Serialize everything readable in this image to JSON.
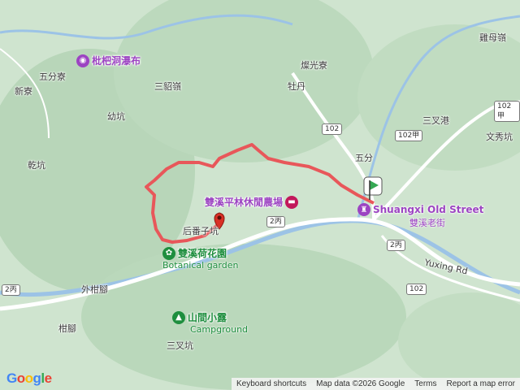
{
  "map": {
    "place_labels": {
      "wufenliao": "五分寮",
      "xinliao": "新寮",
      "sandiaoling": "三貂嶺",
      "youkeng": "幼坑",
      "qiankeng": "乾坑",
      "mudan": "牡丹",
      "canguangliao": "燦光寮",
      "wufen": "五分",
      "sanchagang": "三叉港",
      "wenxiukeng": "文秀坑",
      "queshiliao": "雞母嶺",
      "houpoziliao": "后番子坑",
      "waigankeng": "外柑腳",
      "gankeng": "柑腳",
      "sanchakeng": "三叉坑",
      "yuxing_rd": "Yuxing Rd"
    },
    "route_shields": [
      "102",
      "102甲",
      "102甲",
      "2丙",
      "2丙",
      "102",
      "2丙"
    ],
    "pois": {
      "waterfall": "枇杷洞瀑布",
      "farm": "雙溪平林休閒農場",
      "old_street": "Shuangxi Old Street",
      "old_street_zh": "雙溪老街",
      "lotus": "雙溪荷花園",
      "lotus_en": "Botanical garden",
      "camp": "山間小露",
      "camp_en": "Campground"
    },
    "colors": {
      "route": "#e8575a",
      "road": "#ffffff",
      "water": "#9cc3e6",
      "end_marker": "#d93025",
      "start_marker": "#34a853",
      "poi_purple": "#9c44c2",
      "poi_green": "#1e8e3e"
    }
  },
  "footer": {
    "logo": "Google",
    "keyboard": "Keyboard shortcuts",
    "map_data": "Map data ©2026 Google",
    "terms": "Terms",
    "report": "Report a map error"
  }
}
